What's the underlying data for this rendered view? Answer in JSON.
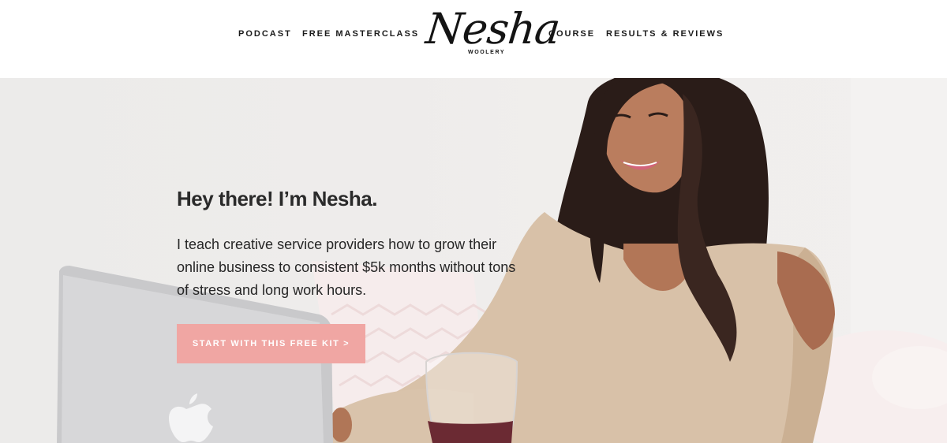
{
  "nav": {
    "left": [
      "PODCAST",
      "FREE MASTERCLASS"
    ],
    "right": [
      "COURSE",
      "RESULTS & REVIEWS"
    ]
  },
  "logo": {
    "script": "Nesha",
    "sub": "WOOLERY"
  },
  "hero": {
    "title": "Hey there! I’m Nesha.",
    "body": "I teach creative service providers how to grow their online business to consistent $5k months without tons of stress and long work hours.",
    "cta": "START WITH THIS FREE KIT >"
  },
  "colors": {
    "accent": "#f0a6a3",
    "text": "#262626",
    "background": "#ffffff"
  }
}
